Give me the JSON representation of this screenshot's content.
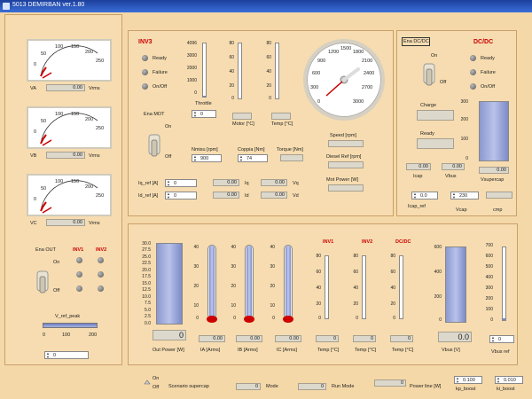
{
  "window": {
    "title": "5013 DEMIRBAN   ver.1.80"
  },
  "colors": {
    "background": "#f5d8a8",
    "panel_border": "#c9a06a",
    "accent_red": "#cc0000",
    "tank_fill": "#8c99cf"
  },
  "meters": [
    {
      "label": "VA",
      "unit": "Vrms",
      "value": "0.00",
      "scale": [
        "0",
        "50",
        "100",
        "150",
        "200",
        "250"
      ]
    },
    {
      "label": "VB",
      "unit": "Vrms",
      "value": "0.00",
      "scale": [
        "0",
        "50",
        "100",
        "150",
        "200",
        "250"
      ]
    },
    {
      "label": "VC",
      "unit": "Vrms",
      "value": "0.00",
      "scale": [
        "0",
        "50",
        "100",
        "150",
        "200",
        "250"
      ]
    }
  ],
  "left_bottom": {
    "ena": "Ena OUT",
    "inv1": "INV1",
    "inv2": "INV2",
    "on": "On",
    "off": "Off",
    "vref_label": "V_ref_peak",
    "vref_scale": [
      "0",
      "100",
      "200"
    ],
    "vref_value": "0"
  },
  "inv3": {
    "title": "INV3",
    "leds": [
      "Ready",
      "Failure",
      "On/Off"
    ],
    "ena_mot": "Ena MOT",
    "on": "On",
    "off": "Off",
    "throttle_scale": [
      "4096",
      "3000",
      "2000",
      "1000",
      "0"
    ],
    "throttle_label": "Throttle",
    "throttle_value": "0",
    "motor_scale": [
      "80",
      "60",
      "40",
      "20",
      "0"
    ],
    "motor_label": "Motor [°C]",
    "temp_scale": [
      "80",
      "60",
      "40",
      "20",
      "0"
    ],
    "temp_label": "Temp [°C]",
    "nmisu_label": "Nmisu [rpm]",
    "nmisu_value": "900",
    "coppia_label": "Coppia [Nm]",
    "coppia_value": "74",
    "torque_label": "Torque [Nm]",
    "iq_ref_label": "Iq_ref [A]",
    "iq_ref_value": "0",
    "id_ref_label": "Id_ref [A]",
    "id_ref_value": "0",
    "iq_value": "0.00",
    "iq_label": "Iq",
    "id_value": "0.00",
    "id_label": "Id",
    "vq_value": "0.00",
    "vq_label": "Vq",
    "vd_value": "0.00",
    "vd_label": "Vd"
  },
  "gauge": {
    "scale": [
      "0",
      "300",
      "600",
      "900",
      "1200",
      "1500",
      "1800",
      "2100",
      "2400",
      "2700",
      "3000"
    ],
    "speed_label": "Speed [rpm]",
    "diesel_label": "Diesel Ref [rpm]",
    "mot_power_label": "Mot Power [W]"
  },
  "dcdc": {
    "ena": "Ena DC/DC",
    "title": "DC/DC",
    "leds": [
      "Ready",
      "Failure",
      "On/Off"
    ],
    "on": "On",
    "off": "Off",
    "charge": "Charge",
    "ready": "Ready",
    "tank_scale": [
      "300",
      "200",
      "100",
      "0"
    ],
    "tank_value": "0.00",
    "vsupercap_label": "Vsupercap",
    "icap_value": "0.00",
    "icap_label": "Icap",
    "vbus_value": "0.00",
    "vbus_label": "Vbus",
    "icap_ref_value": "0.0",
    "icap_ref_label": "Icap_ref",
    "vcap_value": "230",
    "vcap_label": "Vcap",
    "cmp_label": "cmp"
  },
  "bottom": {
    "out_scale": [
      "30.0",
      "27.5",
      "25.0",
      "22.5",
      "20.0",
      "17.5",
      "15.0",
      "12.5",
      "10.0",
      "7.5",
      "5.0",
      "2.5",
      "0.0"
    ],
    "out_value": "0",
    "out_label": "Out Power [W]",
    "therm_scale": [
      "40",
      "30",
      "20",
      "10",
      "0"
    ],
    "ia_value": "0.00",
    "ia_label": "IA [Arms]",
    "ib_value": "0.00",
    "ib_label": "IB [Arms]",
    "ic_value": "0.00",
    "ic_label": "IC [Arms]",
    "inv1": "INV1",
    "inv2": "INV2",
    "dcdc": "DC/DC",
    "temp_scale": [
      "80",
      "60",
      "40",
      "20",
      "0"
    ],
    "temp1_value": "0",
    "temp2_value": "0",
    "temp3_value": "0",
    "temp_label": "Temp [°C]",
    "vbus_scale": [
      "600",
      "400",
      "200",
      "0"
    ],
    "vbus_value": "0.0",
    "vbus_label": "Vbus [V]",
    "vbus_ref_scale": [
      "700",
      "600",
      "500",
      "400",
      "300",
      "200",
      "100",
      "0"
    ],
    "vbus_ref_value": "0",
    "vbus_ref_label": "Vbus ref"
  },
  "status": {
    "on": "On",
    "off": "Off",
    "scenario_label": "Scenario supercap",
    "scenario_value": "0",
    "mode_label": "Mode",
    "mode_value": "0",
    "run_mode_label": "Run Mode",
    "run_mode_value": "0",
    "power_line_label": "Power line [W]",
    "kp_value": "0.100",
    "kp_label": "kp_boost",
    "ki_value": "0.010",
    "ki_label": "ki_boost"
  }
}
